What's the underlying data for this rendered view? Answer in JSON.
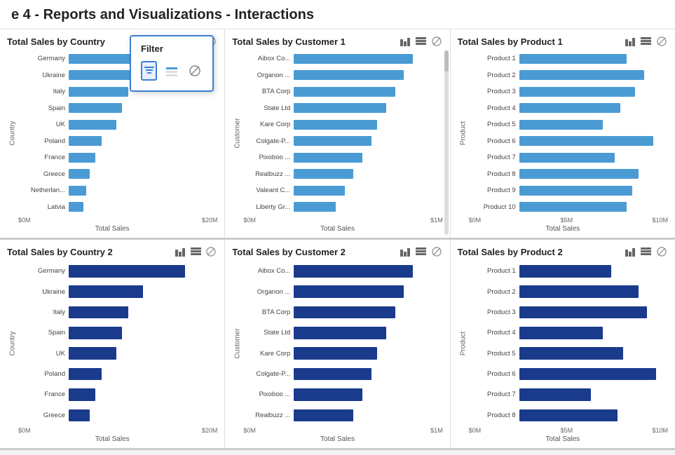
{
  "header": {
    "title": "e 4 - Reports and Visualizations - Interactions"
  },
  "filter_popup": {
    "title": "Filter",
    "icons": [
      "bar_filter",
      "bar_highlight",
      "no_filter"
    ]
  },
  "rows": [
    {
      "charts": [
        {
          "id": "country1",
          "title": "Total Sales by Country",
          "y_label": "Country",
          "x_label": "Total Sales",
          "x_ticks": [
            "$0M",
            "$20M"
          ],
          "color": "light",
          "bars": [
            {
              "label": "Germany",
              "pct": 78
            },
            {
              "label": "Ukraine",
              "pct": 50
            },
            {
              "label": "Italy",
              "pct": 40
            },
            {
              "label": "Spain",
              "pct": 36
            },
            {
              "label": "UK",
              "pct": 32
            },
            {
              "label": "Poland",
              "pct": 22
            },
            {
              "label": "France",
              "pct": 18
            },
            {
              "label": "Greece",
              "pct": 14
            },
            {
              "label": "Netherlan...",
              "pct": 12
            },
            {
              "label": "Latvia",
              "pct": 10
            }
          ]
        },
        {
          "id": "customer1",
          "title": "Total Sales by Customer 1",
          "y_label": "Customer",
          "x_label": "Total Sales",
          "x_ticks": [
            "$0M",
            "$1M"
          ],
          "color": "light",
          "bars": [
            {
              "label": "Aibox Co...",
              "pct": 80
            },
            {
              "label": "Organon ...",
              "pct": 74
            },
            {
              "label": "BTA Corp",
              "pct": 68
            },
            {
              "label": "State Ltd",
              "pct": 62
            },
            {
              "label": "Kare Corp",
              "pct": 56
            },
            {
              "label": "Colgate-P...",
              "pct": 52
            },
            {
              "label": "Pixoboo ...",
              "pct": 46
            },
            {
              "label": "Realbuzz ...",
              "pct": 40
            },
            {
              "label": "Valeant C...",
              "pct": 34
            },
            {
              "label": "Liberty Gr...",
              "pct": 28
            }
          ]
        },
        {
          "id": "product1",
          "title": "Total Sales by Product 1",
          "y_label": "Product",
          "x_label": "Total Sales",
          "x_ticks": [
            "$0M",
            "$5M",
            "$10M"
          ],
          "color": "light",
          "bars": [
            {
              "label": "Product 1",
              "pct": 72
            },
            {
              "label": "Product 2",
              "pct": 84
            },
            {
              "label": "Product 3",
              "pct": 78
            },
            {
              "label": "Product 4",
              "pct": 68
            },
            {
              "label": "Product 5",
              "pct": 56
            },
            {
              "label": "Product 6",
              "pct": 90
            },
            {
              "label": "Product 7",
              "pct": 64
            },
            {
              "label": "Product 8",
              "pct": 80
            },
            {
              "label": "Product 9",
              "pct": 76
            },
            {
              "label": "Product 10",
              "pct": 72
            }
          ]
        }
      ]
    },
    {
      "charts": [
        {
          "id": "country2",
          "title": "Total Sales by Country 2",
          "y_label": "Country",
          "x_label": "Total Sales",
          "x_ticks": [
            "$0M",
            "$20M"
          ],
          "color": "dark",
          "bars": [
            {
              "label": "Germany",
              "pct": 78
            },
            {
              "label": "Ukraine",
              "pct": 50
            },
            {
              "label": "Italy",
              "pct": 40
            },
            {
              "label": "Spain",
              "pct": 36
            },
            {
              "label": "UK",
              "pct": 32
            },
            {
              "label": "Poland",
              "pct": 22
            },
            {
              "label": "France",
              "pct": 18
            },
            {
              "label": "Greece",
              "pct": 14
            }
          ]
        },
        {
          "id": "customer2",
          "title": "Total Sales by Customer 2",
          "y_label": "Customer",
          "x_label": "Total Sales",
          "x_ticks": [
            "$0M",
            "$1M"
          ],
          "color": "dark",
          "bars": [
            {
              "label": "Aibox Co...",
              "pct": 80
            },
            {
              "label": "Organon ...",
              "pct": 74
            },
            {
              "label": "BTA Corp",
              "pct": 68
            },
            {
              "label": "State Ltd",
              "pct": 62
            },
            {
              "label": "Kare Corp",
              "pct": 56
            },
            {
              "label": "Colgate-P...",
              "pct": 52
            },
            {
              "label": "Pixoboo ...",
              "pct": 46
            },
            {
              "label": "Realbuzz ...",
              "pct": 40
            }
          ]
        },
        {
          "id": "product2",
          "title": "Total Sales by Product 2",
          "y_label": "Product",
          "x_label": "Total Sales",
          "x_ticks": [
            "$0M",
            "$5M",
            "$10M"
          ],
          "color": "dark",
          "bars": [
            {
              "label": "Product 1",
              "pct": 62
            },
            {
              "label": "Product 2",
              "pct": 80
            },
            {
              "label": "Product 3",
              "pct": 86
            },
            {
              "label": "Product 4",
              "pct": 56
            },
            {
              "label": "Product 5",
              "pct": 70
            },
            {
              "label": "Product 6",
              "pct": 92
            },
            {
              "label": "Product 7",
              "pct": 48
            },
            {
              "label": "Product 8",
              "pct": 66
            }
          ]
        }
      ]
    }
  ]
}
